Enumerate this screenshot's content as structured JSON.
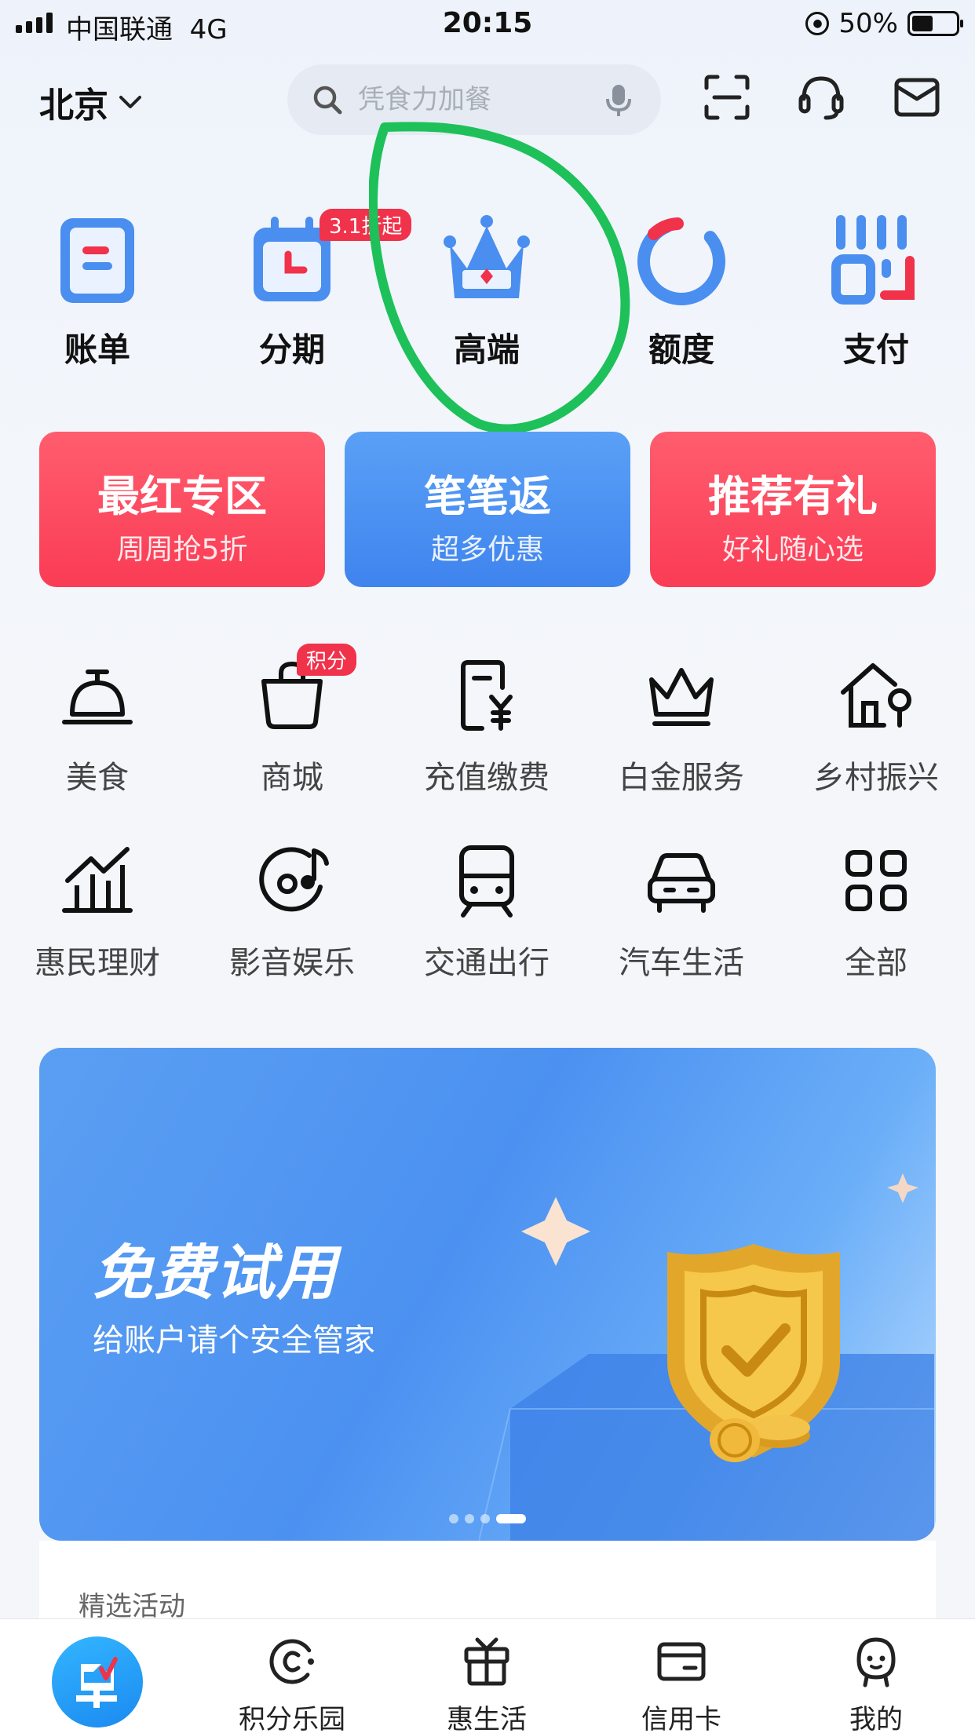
{
  "status_bar": {
    "carrier": "中国联通",
    "network": "4G",
    "time": "20:15",
    "battery": "50%"
  },
  "header": {
    "city": "北京",
    "search_placeholder": "凭食力加餐",
    "icons": [
      "scan-icon",
      "customer-service-icon",
      "message-icon"
    ]
  },
  "top_grid": [
    {
      "label": "账单",
      "icon": "bill-icon"
    },
    {
      "label": "分期",
      "icon": "installment-icon",
      "badge": "3.1折起"
    },
    {
      "label": "高端",
      "icon": "crown-icon"
    },
    {
      "label": "额度",
      "icon": "quota-ring-icon"
    },
    {
      "label": "支付",
      "icon": "payment-code-icon"
    }
  ],
  "promo_cards": [
    {
      "title": "最红专区",
      "subtitle": "周周抢5折",
      "color": "#fa3c55"
    },
    {
      "title": "笔笔返",
      "subtitle": "超多优惠",
      "color": "#3f84ee"
    },
    {
      "title": "推荐有礼",
      "subtitle": "好礼随心选",
      "color": "#fa3c55"
    }
  ],
  "services": [
    {
      "label": "美食",
      "icon": "service-bell-icon"
    },
    {
      "label": "商城",
      "icon": "shopping-bag-icon",
      "badge": "积分"
    },
    {
      "label": "充值缴费",
      "icon": "recharge-icon"
    },
    {
      "label": "白金服务",
      "icon": "platinum-crown-icon"
    },
    {
      "label": "乡村振兴",
      "icon": "rural-house-icon"
    },
    {
      "label": "惠民理财",
      "icon": "finance-chart-icon"
    },
    {
      "label": "影音娱乐",
      "icon": "music-disc-icon"
    },
    {
      "label": "交通出行",
      "icon": "train-icon"
    },
    {
      "label": "汽车生活",
      "icon": "car-icon"
    },
    {
      "label": "全部",
      "icon": "grid-all-icon"
    }
  ],
  "banner": {
    "title": "免费试用",
    "subtitle": "给账户请个安全管家",
    "page_count": 4,
    "active_page": 4
  },
  "section": {
    "title": "精选活动"
  },
  "tabbar": [
    {
      "label": "",
      "icon": "home-logo-icon"
    },
    {
      "label": "积分乐园",
      "icon": "points-icon"
    },
    {
      "label": "惠生活",
      "icon": "tv-gift-icon"
    },
    {
      "label": "信用卡",
      "icon": "wallet-card-icon"
    },
    {
      "label": "我的",
      "icon": "profile-face-icon"
    }
  ],
  "colors": {
    "accent_blue": "#3f84ee",
    "accent_red": "#f0324b",
    "annotation_green": "#1ec05a"
  }
}
